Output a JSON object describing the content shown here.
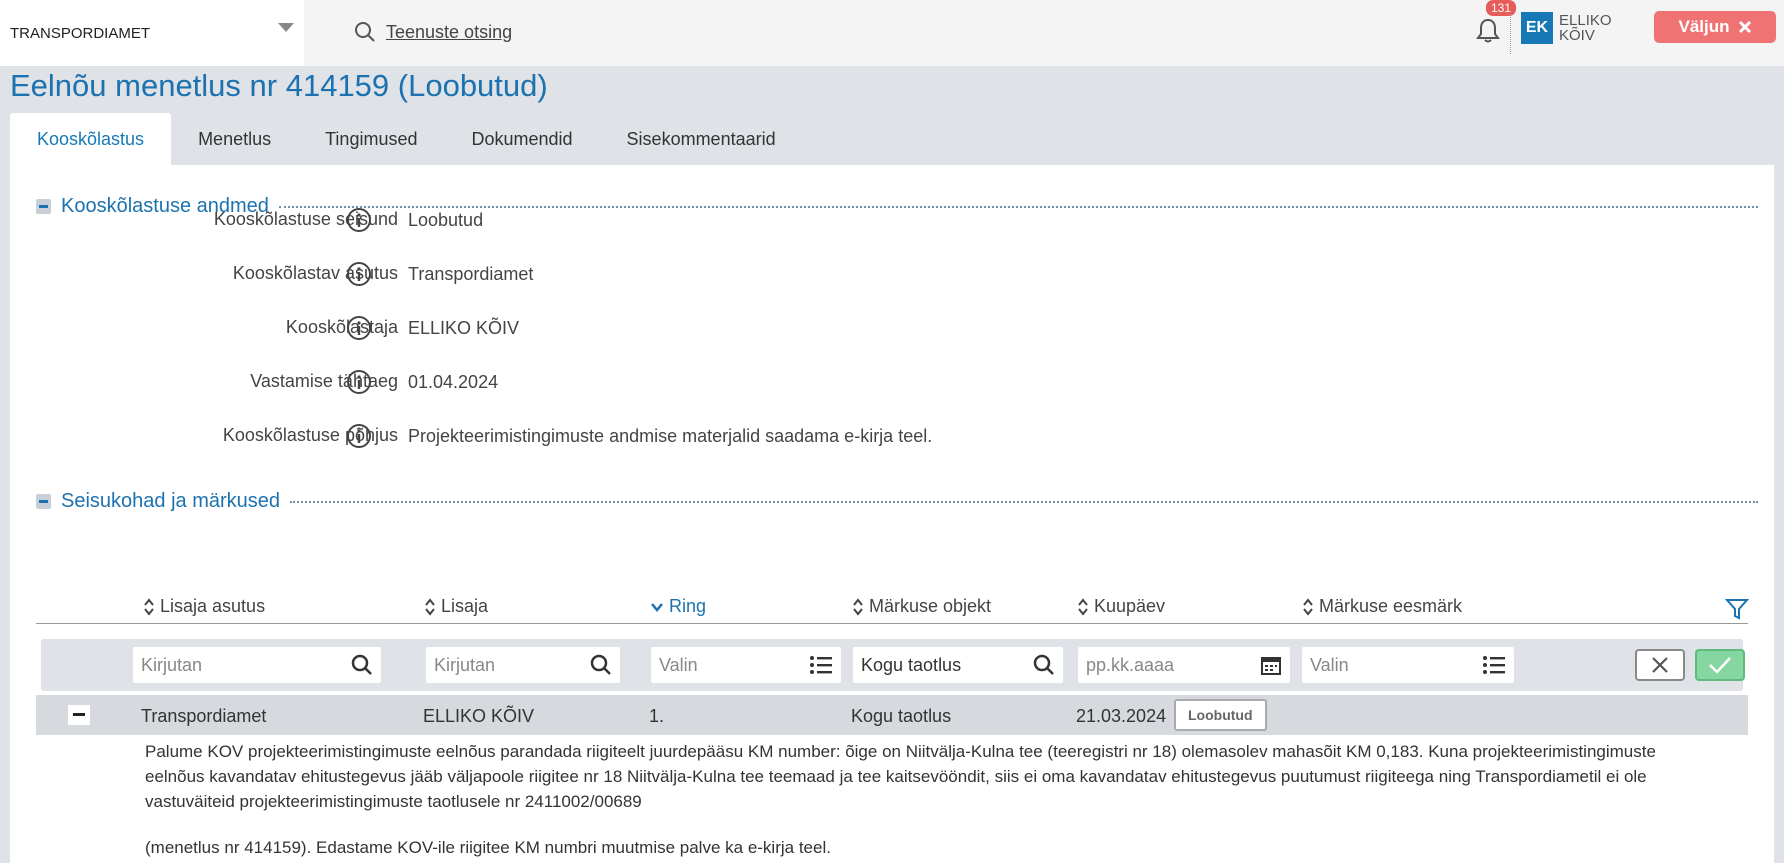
{
  "header": {
    "org_name": "TRANSPORDIAMET",
    "search_label": "Teenuste otsing",
    "notification_count": "131",
    "user_initials": "EK",
    "user_name": "ELLIKO KÕIV",
    "logout_label": "Väljun"
  },
  "page_title": "Eelnõu menetlus nr 414159 (Loobutud)",
  "tabs": [
    {
      "label": "Kooskõlastus",
      "active": true
    },
    {
      "label": "Menetlus"
    },
    {
      "label": "Tingimused"
    },
    {
      "label": "Dokumendid"
    },
    {
      "label": "Sisekommentaarid"
    }
  ],
  "section1": {
    "title": "Kooskõlastuse andmed",
    "fields": [
      {
        "label": "Kooskõlastuse seisund",
        "value": "Loobutud"
      },
      {
        "label": "Kooskõlastav asutus",
        "value": "Transpordiamet"
      },
      {
        "label": "Kooskõlastaja",
        "value": "ELLIKO KÕIV"
      },
      {
        "label": "Vastamise tähtaeg",
        "value": "01.04.2024"
      },
      {
        "label": "Kooskõlastuse põhjus",
        "value": "Projekteerimistingimuste andmise materjalid saadama e-kirja teel."
      }
    ]
  },
  "section2": {
    "title": "Seisukohad ja märkused",
    "columns": [
      "Lisaja asutus",
      "Lisaja",
      "Ring",
      "Märkuse objekt",
      "Kuupäev",
      "Märkuse eesmärk"
    ],
    "filters": {
      "f1": "Kirjutan",
      "f2": "Kirjutan",
      "f3": "Valin",
      "f4_value": "Kogu taotlus",
      "f5": "pp.kk.aaaa",
      "f6": "Valin"
    },
    "row": {
      "asutus": "Transpordiamet",
      "lisaja": "ELLIKO KÕIV",
      "ring": "1.",
      "objekt": "Kogu taotlus",
      "kuupaev": "21.03.2024",
      "eesmark": "Loobutud"
    },
    "comment_p1": "Palume KOV projekteerimistingimuste eelnõus parandada riigiteelt juurdepääsu KM number: õige on Niitvälja-Kulna tee (teeregistri nr 18) olemasolev mahasõit KM 0,183. Kuna projekteerimistingimuste eelnõus kavandatav ehitustegevus jääb väljapoole riigitee nr 18 Niitvälja-Kulna tee teemaad ja tee kaitsevööndit, siis ei oma kavandatav ehitustegevus puutumust riigiteega ning Transpordiametil ei ole vastuväiteid projekteerimistingimuste taotlusele nr 2411002/00689",
    "comment_p2": "(menetlus nr 414159). Edastame KOV-ile riigitee KM numbri muutmise palve ka e-kirja teel."
  },
  "colors": {
    "accent": "#1c72b0",
    "logout": "#f07373",
    "ok": "#86d6a1"
  }
}
